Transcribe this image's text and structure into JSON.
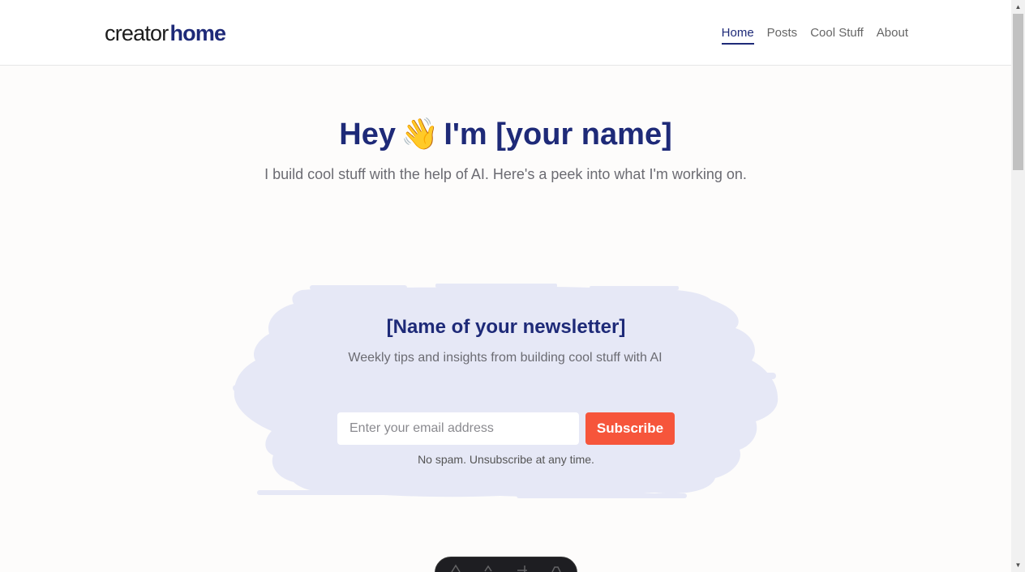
{
  "header": {
    "logo_part1": "creator",
    "logo_part2": "home",
    "nav": [
      {
        "label": "Home",
        "active": true
      },
      {
        "label": "Posts",
        "active": false
      },
      {
        "label": "Cool Stuff",
        "active": false
      },
      {
        "label": "About",
        "active": false
      }
    ]
  },
  "hero": {
    "title_before": "Hey",
    "wave_emoji": "👋",
    "title_after": "I'm [your name]",
    "subtitle": "I build cool stuff with the help of AI. Here's a peek into what I'm working on."
  },
  "newsletter": {
    "title": "[Name of your newsletter]",
    "description": "Weekly tips and insights from building cool stuff with AI",
    "email_placeholder": "Enter your email address",
    "email_value": "",
    "subscribe_label": "Subscribe",
    "note": "No spam. Unsubscribe at any time."
  },
  "colors": {
    "brand_navy": "#1e2a78",
    "accent_orange": "#f6553b",
    "brush_lavender": "#e6e8f6",
    "page_bg": "#fdfcfb"
  },
  "icons": {
    "wave": "waving-hand-icon",
    "scroll_up": "arrow-up-icon",
    "scroll_down": "arrow-down-icon"
  }
}
